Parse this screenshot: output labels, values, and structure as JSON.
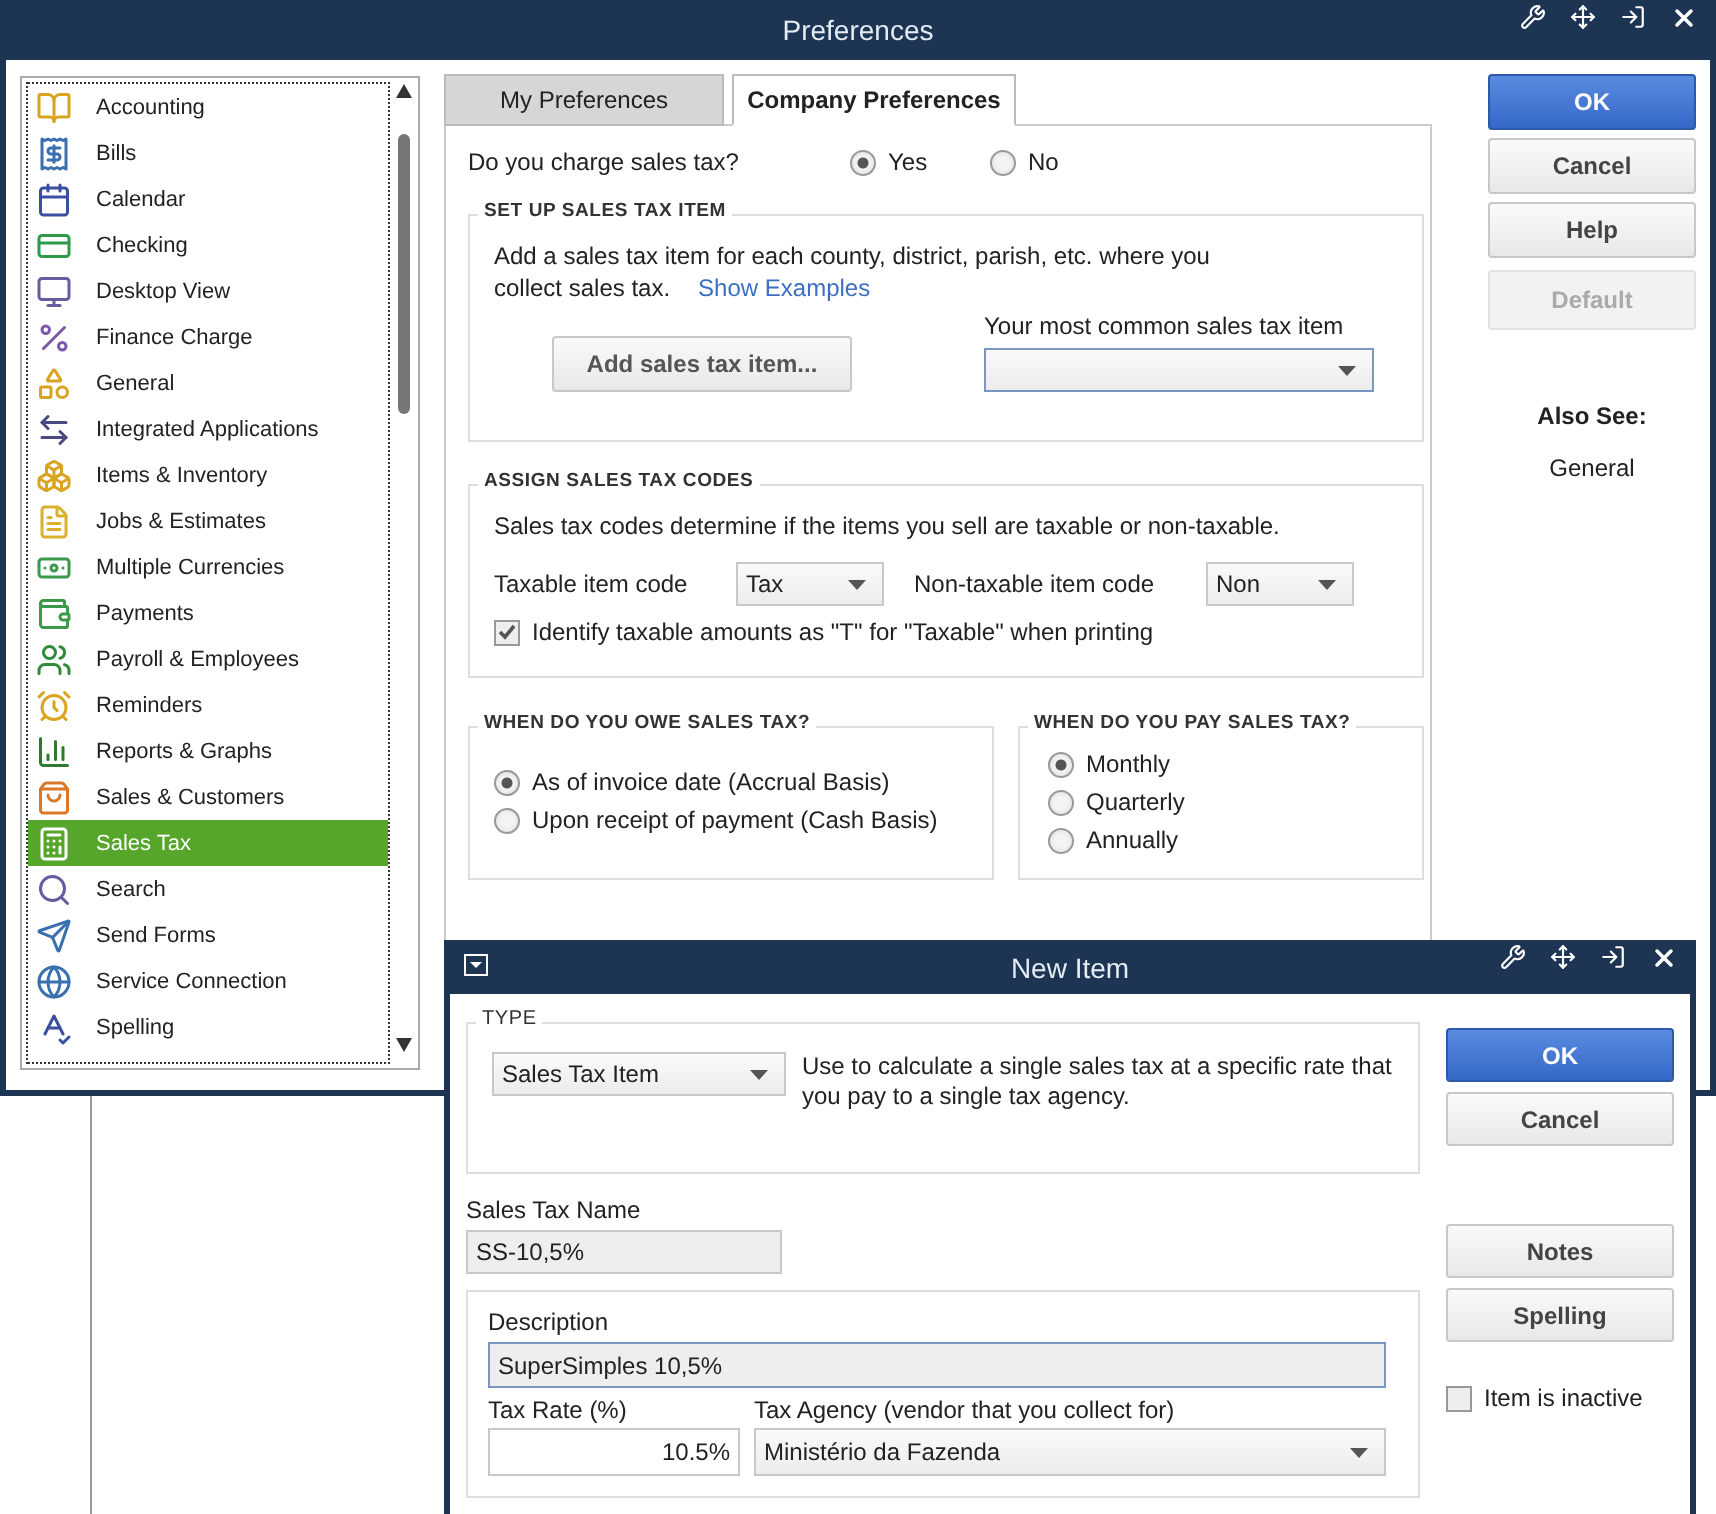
{
  "preferences": {
    "title": "Preferences",
    "categories": [
      {
        "label": "Accounting",
        "selected": false
      },
      {
        "label": "Bills",
        "selected": false
      },
      {
        "label": "Calendar",
        "selected": false
      },
      {
        "label": "Checking",
        "selected": false
      },
      {
        "label": "Desktop View",
        "selected": false
      },
      {
        "label": "Finance Charge",
        "selected": false
      },
      {
        "label": "General",
        "selected": false
      },
      {
        "label": "Integrated Applications",
        "selected": false
      },
      {
        "label": "Items & Inventory",
        "selected": false
      },
      {
        "label": "Jobs & Estimates",
        "selected": false
      },
      {
        "label": "Multiple Currencies",
        "selected": false
      },
      {
        "label": "Payments",
        "selected": false
      },
      {
        "label": "Payroll & Employees",
        "selected": false
      },
      {
        "label": "Reminders",
        "selected": false
      },
      {
        "label": "Reports & Graphs",
        "selected": false
      },
      {
        "label": "Sales & Customers",
        "selected": false
      },
      {
        "label": "Sales Tax",
        "selected": true
      },
      {
        "label": "Search",
        "selected": false
      },
      {
        "label": "Send Forms",
        "selected": false
      },
      {
        "label": "Service Connection",
        "selected": false
      },
      {
        "label": "Spelling",
        "selected": false
      }
    ],
    "tabs": [
      {
        "label": "My Preferences",
        "selected": false
      },
      {
        "label": "Company Preferences",
        "selected": true
      }
    ],
    "charge_question": {
      "label": "Do you charge sales tax?",
      "options": [
        {
          "label": "Yes",
          "selected": true
        },
        {
          "label": "No",
          "selected": false
        }
      ]
    },
    "setup_section": {
      "heading": "SET UP SALES TAX ITEM",
      "text": "Add a sales tax item for each county, district, parish, etc. where you collect sales tax.",
      "link": "Show Examples",
      "add_button": "Add sales tax item...",
      "common_label": "Your most common sales tax item"
    },
    "codes_section": {
      "heading": "ASSIGN SALES TAX CODES",
      "text": "Sales tax codes determine if the items you sell are taxable or non-taxable.",
      "taxable_label": "Taxable item code",
      "taxable_value": "Tax",
      "nontaxable_label": "Non-taxable item code",
      "nontaxable_value": "Non",
      "identify": {
        "label": "Identify taxable amounts as \"T\" for \"Taxable\" when printing",
        "checked": true
      }
    },
    "owe_section": {
      "heading": "WHEN DO YOU OWE SALES TAX?",
      "options": [
        {
          "label": "As of invoice date (Accrual Basis)",
          "selected": true
        },
        {
          "label": "Upon receipt of payment (Cash Basis)",
          "selected": false
        }
      ]
    },
    "pay_section": {
      "heading": "WHEN DO YOU PAY SALES TAX?",
      "options": [
        {
          "label": "Monthly",
          "selected": true
        },
        {
          "label": "Quarterly",
          "selected": false
        },
        {
          "label": "Annually",
          "selected": false
        }
      ]
    },
    "buttons": [
      {
        "label": "OK",
        "kind": "primary"
      },
      {
        "label": "Cancel",
        "kind": "normal"
      },
      {
        "label": "Help",
        "kind": "normal"
      },
      {
        "label": "Default",
        "kind": "disabled"
      }
    ],
    "also_see": {
      "heading": "Also See:",
      "links": [
        "General"
      ]
    }
  },
  "new_item": {
    "title": "New Item",
    "type_section": {
      "heading": "TYPE",
      "value": "Sales Tax Item",
      "description": "Use to calculate a single sales tax at a specific rate that you pay to a single tax agency."
    },
    "name_label": "Sales Tax Name",
    "name_value": "SS-10,5%",
    "description_label": "Description",
    "description_value": "SuperSimples 10,5%",
    "rate_label": "Tax Rate (%)",
    "rate_value": "10.5%",
    "agency_label": "Tax Agency (vendor that you collect for)",
    "agency_value": "Ministério da Fazenda",
    "top_buttons": [
      {
        "label": "OK",
        "kind": "primary"
      },
      {
        "label": "Cancel",
        "kind": "normal"
      }
    ],
    "bottom_buttons": [
      {
        "label": "Notes",
        "kind": "normal"
      },
      {
        "label": "Spelling",
        "kind": "normal"
      }
    ],
    "inactive": {
      "label": "Item is inactive",
      "checked": false
    }
  }
}
